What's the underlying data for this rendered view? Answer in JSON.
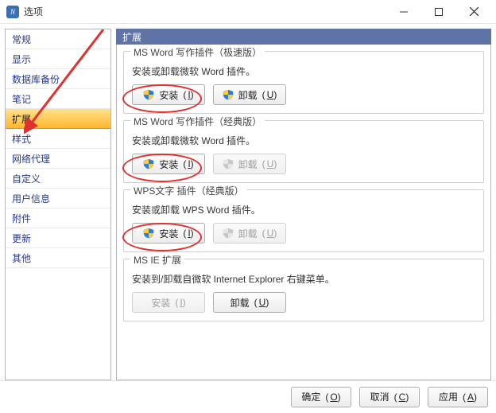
{
  "window": {
    "title": "选项"
  },
  "sidebar": {
    "items": [
      {
        "label": "常规"
      },
      {
        "label": "显示"
      },
      {
        "label": "数据库备份"
      },
      {
        "label": "笔记"
      },
      {
        "label": "扩展"
      },
      {
        "label": "样式"
      },
      {
        "label": "网络代理"
      },
      {
        "label": "自定义"
      },
      {
        "label": "用户信息"
      },
      {
        "label": "附件"
      },
      {
        "label": "更新"
      },
      {
        "label": "其他"
      }
    ],
    "selected_index": 4
  },
  "panel": {
    "header": "扩展",
    "groups": [
      {
        "title": "MS Word 写作插件（极速版）",
        "desc": "安装或卸载微软 Word 插件。",
        "install": {
          "label": "安装",
          "hotkey": "I",
          "shield": true,
          "enabled": true
        },
        "uninstall": {
          "label": "卸载",
          "hotkey": "U",
          "shield": true,
          "enabled": true
        }
      },
      {
        "title": "MS Word 写作插件（经典版）",
        "desc": "安装或卸载微软 Word 插件。",
        "install": {
          "label": "安装",
          "hotkey": "I",
          "shield": true,
          "enabled": true
        },
        "uninstall": {
          "label": "卸载",
          "hotkey": "U",
          "shield": true,
          "enabled": false
        }
      },
      {
        "title": "WPS文字 插件（经典版）",
        "desc": "安装或卸载 WPS Word 插件。",
        "install": {
          "label": "安装",
          "hotkey": "I",
          "shield": true,
          "enabled": true
        },
        "uninstall": {
          "label": "卸载",
          "hotkey": "U",
          "shield": true,
          "enabled": false
        }
      },
      {
        "title": "MS IE 扩展",
        "desc": "安装到/卸载自微软 Internet Explorer 右键菜单。",
        "install": {
          "label": "安装",
          "hotkey": "I",
          "shield": false,
          "enabled": false
        },
        "uninstall": {
          "label": "卸载",
          "hotkey": "U",
          "shield": false,
          "enabled": true
        }
      }
    ]
  },
  "footer": {
    "ok": {
      "label": "确定",
      "hotkey": "O"
    },
    "cancel": {
      "label": "取消",
      "hotkey": "C"
    },
    "apply": {
      "label": "应用",
      "hotkey": "A"
    }
  },
  "annotations": {
    "highlight_group_indices": [
      0,
      1,
      2
    ]
  }
}
